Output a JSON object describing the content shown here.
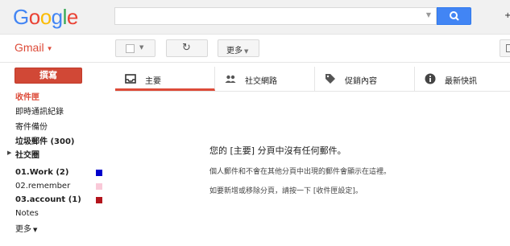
{
  "header": {
    "logo_letters": [
      "G",
      "o",
      "o",
      "g",
      "l",
      "e"
    ],
    "logo_colors": [
      "#4285f4",
      "#ea4335",
      "#fbbc05",
      "#4285f4",
      "#34a853",
      "#ea4335"
    ],
    "search_value": "",
    "partial_text": "+",
    "search_button_color": "#4285f4",
    "search_icon": "search-icon"
  },
  "subbar": {
    "gmail_label": "Gmail",
    "more_label": "更多",
    "refresh_icon": "refresh-icon"
  },
  "sidebar": {
    "compose_label": "撰寫",
    "items": [
      {
        "label": "收件匣",
        "state": "active"
      },
      {
        "label": "即時通訊紀錄"
      },
      {
        "label": "寄件備份"
      },
      {
        "label": "垃圾郵件 (300)",
        "state": "bold"
      },
      {
        "label": "社交圈",
        "state": "bold",
        "expandable": true
      },
      {
        "label": "01.Work (2)",
        "state": "bold",
        "color": "#0000cc"
      },
      {
        "label": "02.remember",
        "color": "#f9c9d8"
      },
      {
        "label": "03.account (1)",
        "state": "bold",
        "color": "#b3141c"
      },
      {
        "label": "Notes"
      },
      {
        "label": "更多"
      }
    ]
  },
  "tabs": [
    {
      "label": "主要",
      "icon": "inbox-icon",
      "active": true
    },
    {
      "label": "社交網路",
      "icon": "people-icon"
    },
    {
      "label": "促銷內容",
      "icon": "tag-icon"
    },
    {
      "label": "最新快訊",
      "icon": "info-icon"
    }
  ],
  "empty_state": {
    "main": "您的 [主要] 分頁中沒有任何郵件。",
    "line1": "個人郵件和不會在其他分頁中出現的郵件會顯示在這裡。",
    "line2": "如要新增或移除分頁，請按一下 [收件匣設定]。"
  },
  "accent_color": "#dd4b39"
}
